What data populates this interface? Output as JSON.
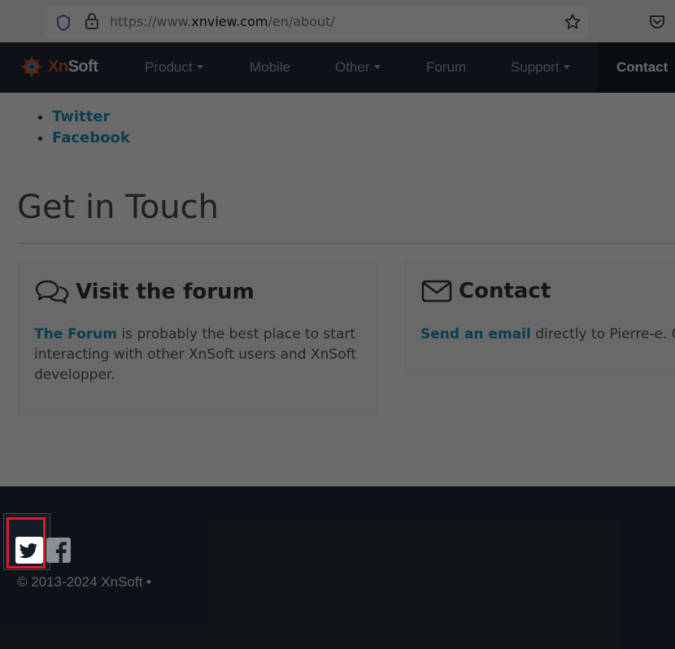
{
  "browser": {
    "url_prefix": "https://www.",
    "url_domain": "xnview.com",
    "url_path": "/en/about/"
  },
  "navbar": {
    "logo_xn": "Xn",
    "logo_soft": "Soft",
    "items": [
      {
        "label": "Product",
        "dropdown": true
      },
      {
        "label": "Mobile",
        "dropdown": false
      },
      {
        "label": "Other",
        "dropdown": true
      },
      {
        "label": "Forum",
        "dropdown": false
      },
      {
        "label": "Support",
        "dropdown": true
      }
    ],
    "contact_label": "Contact"
  },
  "social_list": [
    "Twitter",
    "Facebook"
  ],
  "section": {
    "title": "Get in Touch"
  },
  "forum_card": {
    "title": "Visit the forum",
    "link": "The Forum",
    "text": " is probably the best place to start interacting with other XnSoft users and XnSoft developper."
  },
  "contact_card": {
    "title": "Contact",
    "link": "Send an email",
    "text": " directly to Pierre-e. Go"
  },
  "footer": {
    "copyright": "© 2013-2024 XnSoft •"
  },
  "colors": {
    "navbar_bg": "#212d3a",
    "link": "#1f8fc2",
    "accent_logo": "#e0532c",
    "focus_ring": "#e0192b"
  }
}
